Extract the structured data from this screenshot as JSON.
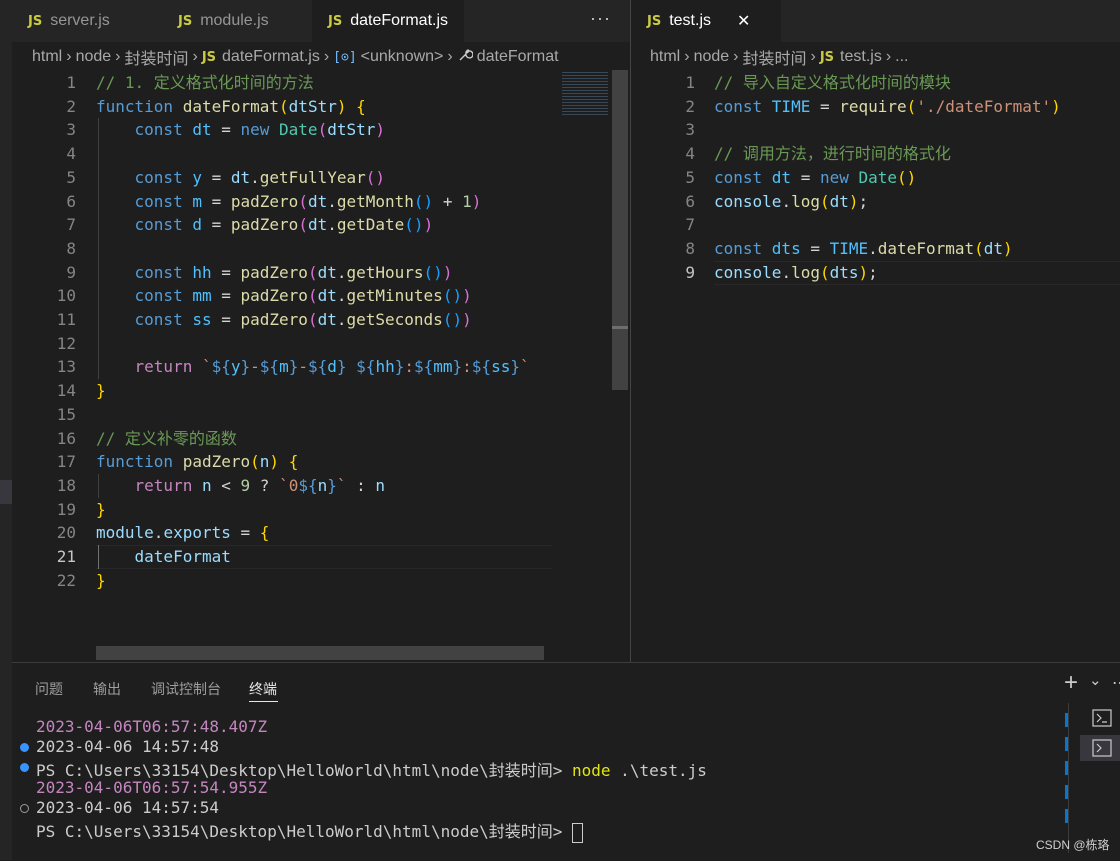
{
  "left_tabs": [
    {
      "label": "server.js",
      "active": false
    },
    {
      "label": "module.js",
      "active": false
    },
    {
      "label": "dateFormat.js",
      "active": true
    }
  ],
  "left_more": "···",
  "right_tab": {
    "label": "test.js",
    "close": "✕"
  },
  "left_breadcrumb": [
    "html",
    "node",
    "封装时间",
    "dateFormat.js",
    "<unknown>",
    "dateFormat"
  ],
  "right_breadcrumb": [
    "html",
    "node",
    "封装时间",
    "test.js",
    "..."
  ],
  "js_badge": "JS",
  "left_code": {
    "line_numbers": [
      "1",
      "2",
      "3",
      "4",
      "5",
      "6",
      "7",
      "8",
      "9",
      "10",
      "11",
      "12",
      "13",
      "14",
      "15",
      "16",
      "17",
      "18",
      "19",
      "20",
      "21",
      "22"
    ],
    "current_line": 21,
    "lines": [
      [
        [
          "com",
          "// 1. 定义格式化时间的方法"
        ]
      ],
      [
        [
          "kw",
          "function "
        ],
        [
          "fn",
          "dateFormat"
        ],
        [
          "b1",
          "("
        ],
        [
          "var",
          "dtStr"
        ],
        [
          "b1",
          ")"
        ],
        [
          "op",
          " "
        ],
        [
          "b1",
          "{"
        ]
      ],
      [
        [
          "op",
          "    "
        ],
        [
          "kw",
          "const "
        ],
        [
          "const",
          "dt"
        ],
        [
          "op",
          " = "
        ],
        [
          "kw",
          "new "
        ],
        [
          "cls",
          "Date"
        ],
        [
          "b2",
          "("
        ],
        [
          "var",
          "dtStr"
        ],
        [
          "b2",
          ")"
        ]
      ],
      [],
      [
        [
          "op",
          "    "
        ],
        [
          "kw",
          "const "
        ],
        [
          "const",
          "y"
        ],
        [
          "op",
          " = "
        ],
        [
          "var",
          "dt"
        ],
        [
          "op",
          "."
        ],
        [
          "fn",
          "getFullYear"
        ],
        [
          "b2",
          "()"
        ]
      ],
      [
        [
          "op",
          "    "
        ],
        [
          "kw",
          "const "
        ],
        [
          "const",
          "m"
        ],
        [
          "op",
          " = "
        ],
        [
          "fn",
          "padZero"
        ],
        [
          "b2",
          "("
        ],
        [
          "var",
          "dt"
        ],
        [
          "op",
          "."
        ],
        [
          "fn",
          "getMonth"
        ],
        [
          "b3",
          "()"
        ],
        [
          "op",
          " + "
        ],
        [
          "num",
          "1"
        ],
        [
          "b2",
          ")"
        ]
      ],
      [
        [
          "op",
          "    "
        ],
        [
          "kw",
          "const "
        ],
        [
          "const",
          "d"
        ],
        [
          "op",
          " = "
        ],
        [
          "fn",
          "padZero"
        ],
        [
          "b2",
          "("
        ],
        [
          "var",
          "dt"
        ],
        [
          "op",
          "."
        ],
        [
          "fn",
          "getDate"
        ],
        [
          "b3",
          "()"
        ],
        [
          "b2",
          ")"
        ]
      ],
      [],
      [
        [
          "op",
          "    "
        ],
        [
          "kw",
          "const "
        ],
        [
          "const",
          "hh"
        ],
        [
          "op",
          " = "
        ],
        [
          "fn",
          "padZero"
        ],
        [
          "b2",
          "("
        ],
        [
          "var",
          "dt"
        ],
        [
          "op",
          "."
        ],
        [
          "fn",
          "getHours"
        ],
        [
          "b3",
          "()"
        ],
        [
          "b2",
          ")"
        ]
      ],
      [
        [
          "op",
          "    "
        ],
        [
          "kw",
          "const "
        ],
        [
          "const",
          "mm"
        ],
        [
          "op",
          " = "
        ],
        [
          "fn",
          "padZero"
        ],
        [
          "b2",
          "("
        ],
        [
          "var",
          "dt"
        ],
        [
          "op",
          "."
        ],
        [
          "fn",
          "getMinutes"
        ],
        [
          "b3",
          "()"
        ],
        [
          "b2",
          ")"
        ]
      ],
      [
        [
          "op",
          "    "
        ],
        [
          "kw",
          "const "
        ],
        [
          "const",
          "ss"
        ],
        [
          "op",
          " = "
        ],
        [
          "fn",
          "padZero"
        ],
        [
          "b2",
          "("
        ],
        [
          "var",
          "dt"
        ],
        [
          "op",
          "."
        ],
        [
          "fn",
          "getSeconds"
        ],
        [
          "b3",
          "()"
        ],
        [
          "b2",
          ")"
        ]
      ],
      [],
      [
        [
          "op",
          "    "
        ],
        [
          "ctrl",
          "return "
        ],
        [
          "tpl",
          "`"
        ],
        [
          "tplp",
          "${"
        ],
        [
          "const",
          "y"
        ],
        [
          "tplp",
          "}"
        ],
        [
          "tpl",
          "-"
        ],
        [
          "tplp",
          "${"
        ],
        [
          "const",
          "m"
        ],
        [
          "tplp",
          "}"
        ],
        [
          "tpl",
          "-"
        ],
        [
          "tplp",
          "${"
        ],
        [
          "const",
          "d"
        ],
        [
          "tplp",
          "}"
        ],
        [
          "tpl",
          " "
        ],
        [
          "tplp",
          "${"
        ],
        [
          "const",
          "hh"
        ],
        [
          "tplp",
          "}"
        ],
        [
          "tpl",
          ":"
        ],
        [
          "tplp",
          "${"
        ],
        [
          "const",
          "mm"
        ],
        [
          "tplp",
          "}"
        ],
        [
          "tpl",
          ":"
        ],
        [
          "tplp",
          "${"
        ],
        [
          "const",
          "ss"
        ],
        [
          "tplp",
          "}"
        ],
        [
          "tpl",
          "`"
        ]
      ],
      [
        [
          "b1",
          "}"
        ]
      ],
      [],
      [
        [
          "com",
          "// 定义补零的函数"
        ]
      ],
      [
        [
          "kw",
          "function "
        ],
        [
          "fn",
          "padZero"
        ],
        [
          "b1",
          "("
        ],
        [
          "var",
          "n"
        ],
        [
          "b1",
          ")"
        ],
        [
          "op",
          " "
        ],
        [
          "b1",
          "{"
        ]
      ],
      [
        [
          "op",
          "    "
        ],
        [
          "ctrl",
          "return "
        ],
        [
          "var",
          "n"
        ],
        [
          "op",
          " < "
        ],
        [
          "num",
          "9"
        ],
        [
          "op",
          " ? "
        ],
        [
          "tpl",
          "`0"
        ],
        [
          "tplp",
          "${"
        ],
        [
          "var",
          "n"
        ],
        [
          "tplp",
          "}"
        ],
        [
          "tpl",
          "`"
        ],
        [
          "op",
          " : "
        ],
        [
          "var",
          "n"
        ]
      ],
      [
        [
          "b1",
          "}"
        ]
      ],
      [
        [
          "var",
          "module"
        ],
        [
          "op",
          "."
        ],
        [
          "var",
          "exports"
        ],
        [
          "op",
          " = "
        ],
        [
          "b1",
          "{"
        ]
      ],
      [
        [
          "op",
          "    "
        ],
        [
          "var",
          "dateFormat"
        ]
      ],
      [
        [
          "b1",
          "}"
        ]
      ]
    ]
  },
  "right_code": {
    "line_numbers": [
      "1",
      "2",
      "3",
      "4",
      "5",
      "6",
      "7",
      "8",
      "9"
    ],
    "current_line": 9,
    "lines": [
      [
        [
          "com",
          "// 导入自定义格式化时间的模块"
        ]
      ],
      [
        [
          "kw",
          "const "
        ],
        [
          "const",
          "TIME"
        ],
        [
          "op",
          " = "
        ],
        [
          "fn",
          "require"
        ],
        [
          "b1",
          "("
        ],
        [
          "str",
          "'./dateFormat'"
        ],
        [
          "b1",
          ")"
        ]
      ],
      [],
      [
        [
          "com",
          "// 调用方法，进行时间的格式化"
        ]
      ],
      [
        [
          "kw",
          "const "
        ],
        [
          "const",
          "dt"
        ],
        [
          "op",
          " = "
        ],
        [
          "kw",
          "new "
        ],
        [
          "cls",
          "Date"
        ],
        [
          "b1",
          "()"
        ]
      ],
      [
        [
          "var",
          "console"
        ],
        [
          "op",
          "."
        ],
        [
          "fn",
          "log"
        ],
        [
          "b1",
          "("
        ],
        [
          "var",
          "dt"
        ],
        [
          "b1",
          ")"
        ],
        [
          "op",
          ";"
        ]
      ],
      [],
      [
        [
          "kw",
          "const "
        ],
        [
          "const",
          "dts"
        ],
        [
          "op",
          " = "
        ],
        [
          "const",
          "TIME"
        ],
        [
          "op",
          "."
        ],
        [
          "fn",
          "dateFormat"
        ],
        [
          "b1",
          "("
        ],
        [
          "var",
          "dt"
        ],
        [
          "b1",
          ")"
        ]
      ],
      [
        [
          "var",
          "console"
        ],
        [
          "op",
          "."
        ],
        [
          "fn",
          "log"
        ],
        [
          "b1",
          "("
        ],
        [
          "var",
          "dts"
        ],
        [
          "b1",
          ")"
        ],
        [
          "op",
          ";"
        ]
      ]
    ]
  },
  "panel_tabs": [
    {
      "label": "问题",
      "active": false
    },
    {
      "label": "输出",
      "active": false
    },
    {
      "label": "调试控制台",
      "active": false
    },
    {
      "label": "终端",
      "active": true
    }
  ],
  "panel_actions": {
    "add": "+",
    "chevron": "⌄",
    "more": "⋯"
  },
  "terminal": [
    {
      "text": "2023-04-06T06:57:48.407Z",
      "color": "#c586c0",
      "marker": "none"
    },
    {
      "text": "2023-04-06 14:57:48",
      "color": "#cccccc",
      "marker": "filled"
    },
    {
      "prompt": "PS C:\\Users\\33154\\Desktop\\HelloWorld\\html\\node\\封装时间> ",
      "cmd": "node",
      "arg": " .\\test.js",
      "marker": "filled"
    },
    {
      "text": "2023-04-06T06:57:54.955Z",
      "color": "#c586c0",
      "marker": "none"
    },
    {
      "text": "2023-04-06 14:57:54",
      "color": "#cccccc",
      "marker": "hollow"
    },
    {
      "prompt": "PS C:\\Users\\33154\\Desktop\\HelloWorld\\html\\node\\封装时间> ",
      "cursor": true,
      "marker": "none"
    }
  ],
  "watermark": "CSDN @栋珞",
  "colors": {
    "marker_blue": "#3794ff",
    "command_yellow": "#e5e510",
    "accent_blue": "#0078d4"
  }
}
